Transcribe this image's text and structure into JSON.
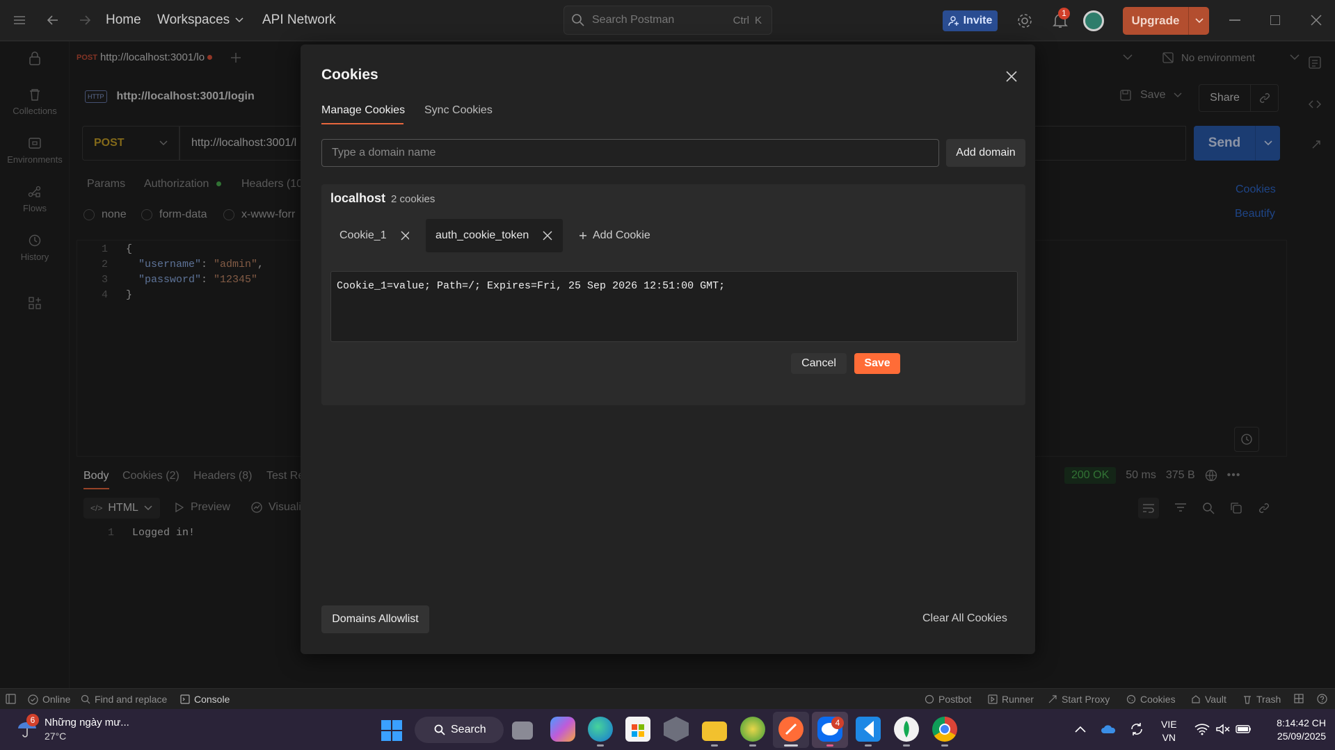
{
  "topbar": {
    "home": "Home",
    "workspaces": "Workspaces",
    "api_network": "API Network",
    "search_placeholder": "Search Postman",
    "kbd_ctrl": "Ctrl",
    "kbd_k": "K",
    "invite": "Invite",
    "notification_count": "1",
    "upgrade": "Upgrade"
  },
  "sidebar": {
    "items": [
      {
        "label": "Collections",
        "icon": "trash-can-icon"
      },
      {
        "label": "Environments",
        "icon": "environment-icon"
      },
      {
        "label": "Flows",
        "icon": "flows-icon"
      },
      {
        "label": "History",
        "icon": "history-icon"
      }
    ]
  },
  "request": {
    "tab_method": "POST",
    "tab_url": "http://localhost:3001/lo",
    "title": "http://localhost:3001/login",
    "method": "POST",
    "url": "http://localhost:3001/l",
    "no_environment": "No environment",
    "save": "Save",
    "share": "Share",
    "send": "Send",
    "tabs": [
      "Params",
      "Authorization",
      "Headers (10"
    ],
    "body_modes": [
      "none",
      "form-data",
      "x-www-forr"
    ],
    "cookies_link": "Cookies",
    "beautify_link": "Beautify",
    "code_lines": [
      {
        "n": "1",
        "text": "{"
      },
      {
        "n": "2",
        "key": "\"username\"",
        "val": "\"admin\""
      },
      {
        "n": "3",
        "key": "\"password\"",
        "val": "\"12345\""
      },
      {
        "n": "4",
        "text": "}"
      }
    ]
  },
  "response": {
    "tabs": [
      "Body",
      "Cookies (2)",
      "Headers (8)",
      "Test Re"
    ],
    "format": "HTML",
    "preview": "Preview",
    "visualize": "Visuali",
    "status": "200 OK",
    "time": "50 ms",
    "size": "375 B",
    "line_no": "1",
    "line_text": "Logged in!"
  },
  "modal": {
    "title": "Cookies",
    "tab_manage": "Manage Cookies",
    "tab_sync": "Sync Cookies",
    "domain_placeholder": "Type a domain name",
    "add_domain": "Add domain",
    "domain": "localhost",
    "cookie_count": "2 cookies",
    "cookies": [
      "Cookie_1",
      "auth_cookie_token"
    ],
    "add_cookie": "Add Cookie",
    "cookie_value": "Cookie_1=value; Path=/; Expires=Fri, 25 Sep 2026 12:51:00 GMT;",
    "cancel": "Cancel",
    "save": "Save",
    "domains_allowlist": "Domains Allowlist",
    "clear_all": "Clear All Cookies"
  },
  "statusbar": {
    "online": "Online",
    "find_replace": "Find and replace",
    "console": "Console",
    "postbot": "Postbot",
    "runner": "Runner",
    "start_proxy": "Start Proxy",
    "cookies": "Cookies",
    "vault": "Vault",
    "trash": "Trash"
  },
  "taskbar": {
    "weather_badge": "6",
    "weather_title": "Những ngày mư...",
    "weather_temp": "27°C",
    "search": "Search",
    "zalo_badge": "4",
    "lang_top": "VIE",
    "lang_bottom": "VN",
    "time": "8:14:42 CH",
    "date": "25/09/2025"
  },
  "colors": {
    "accent": "#ff6c37",
    "send": "#2a5db0",
    "invite": "#2a4d92",
    "status_ok": "#4caf50"
  }
}
